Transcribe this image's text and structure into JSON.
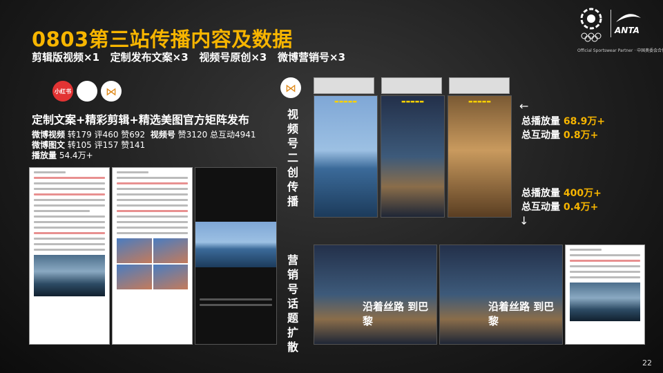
{
  "title": "0803第三站传播内容及数据",
  "subtitle": "剪辑版视频×1   定制发布文案×3   视频号原创×3   微博营销号×3",
  "brand": {
    "name": "ANTA",
    "tagline": "Official Sportswear Partner · 中国奥委会合作伙伴"
  },
  "platform_icons": [
    "xiaohongshu-icon",
    "weibo-icon",
    "wechat-channels-icon"
  ],
  "xiaohongshu_label": "小红书",
  "lead": "定制文案+精彩剪辑+精选美图官方矩阵发布",
  "stats": {
    "weibo_video": {
      "label": "微博视频",
      "text": "转179 评460 赞692"
    },
    "channels": {
      "label": "视频号",
      "text": "赞3120 总互动4941"
    },
    "weibo_image": {
      "label": "微博图文",
      "text": "转105 评157 赞141"
    },
    "plays": {
      "label": "播放量",
      "text": "54.4万+"
    }
  },
  "vertical_labels": {
    "channels_secondary": "视频号二创传播",
    "marketing_topics": "营销号话题扩散"
  },
  "right_stats": {
    "top": {
      "plays_label": "总播放量",
      "plays_value": "68.9万+",
      "interactions_label": "总互动量",
      "interactions_value": "0.8万+"
    },
    "bottom": {
      "plays_label": "总播放量",
      "plays_value": "400万+",
      "interactions_label": "总互动量",
      "interactions_value": "0.4万+"
    },
    "arrow_up": "←",
    "arrow_down": "↓"
  },
  "overlay_texts": {
    "road": "沿着丝路 到巴黎"
  },
  "page_number": "22",
  "colors": {
    "accent": "#f7b500",
    "background": "#1f1f1f"
  }
}
